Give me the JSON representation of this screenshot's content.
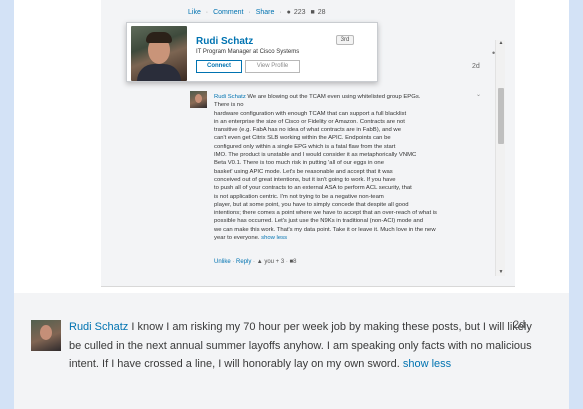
{
  "top_actions": {
    "like": "Like",
    "comment": "Comment",
    "share": "Share",
    "likes_count": "223",
    "comments_count": "28",
    "separator": "·"
  },
  "hover_card": {
    "name": "Rudi Schatz",
    "title": "IT Program Manager at Cisco Systems",
    "degree": "3rd",
    "connect": "Connect",
    "view_profile": "View Profile"
  },
  "upper_comment": {
    "truncated_text": "chatz",
    "time": "2d",
    "menu": "•"
  },
  "reply": {
    "author": "Rudi Schatz",
    "lines": [
      "We are blowing out the TCAM even using whitelisted group EPGs.",
      "There is no",
      "hardware configuration with enough TCAM that can support a full blacklist",
      "in an enterprise the size of Cisco or Fidelity or Amazon. Contracts are not",
      "transitive (e.g. FabA has no idea of what contracts are in FabB), and we",
      "can't even get Citrix SLB working within the APIC. Endpoints can be",
      "configured only within a single EPG which is a fatal flaw from the start",
      "IMO. The product is unstable and I would consider it as metaphorically VNMC",
      "Beta V0.1. There is too much risk in putting 'all of our eggs in one",
      "basket' using APIC mode. Let's be reasonable and accept that it was",
      "conceived out of great intentions, but it isn't going to work. If you have",
      "to push all of your contracts to an external ASA to perform ACL security, that",
      "is not application centric. I'm not trying to be a negative non-team",
      "player, but at some point, you have to simply concede that despite all good",
      "intentions; there comes a point where we have to accept that an over-reach of what is",
      "possible has occurred. Let's just use the N9Ks in traditional (non-ACI) mode and",
      "we can make this work. That's my data point. Take it or leave it. Much love in the new",
      "year to everyone."
    ],
    "show_less": "show less",
    "actions": {
      "unlike": "Unlike",
      "reply": "Reply",
      "likes": "you + 3",
      "replies": "8",
      "separator": "·"
    }
  },
  "lower_comment": {
    "author": "Rudi Schatz",
    "text": "I know I am risking my 70 hour per week job by making these posts, but I will likely be culled in the next annual summer layoffs anyhow. I am speaking only facts with no malicious intent. If I have crossed a line, I will honorably lay on my own sword.",
    "show_less": "show less",
    "time": "2d"
  },
  "icons": {
    "like": "thumbs-up-icon",
    "comment": "speech-bubble-icon",
    "scroll_up": "triangle-up-icon",
    "scroll_down": "triangle-down-icon",
    "chevron": "chevron-down-icon"
  },
  "colors": {
    "link": "#0073b1",
    "page_edge": "#d3e2f6",
    "panel_bg": "#f3f4f6"
  }
}
